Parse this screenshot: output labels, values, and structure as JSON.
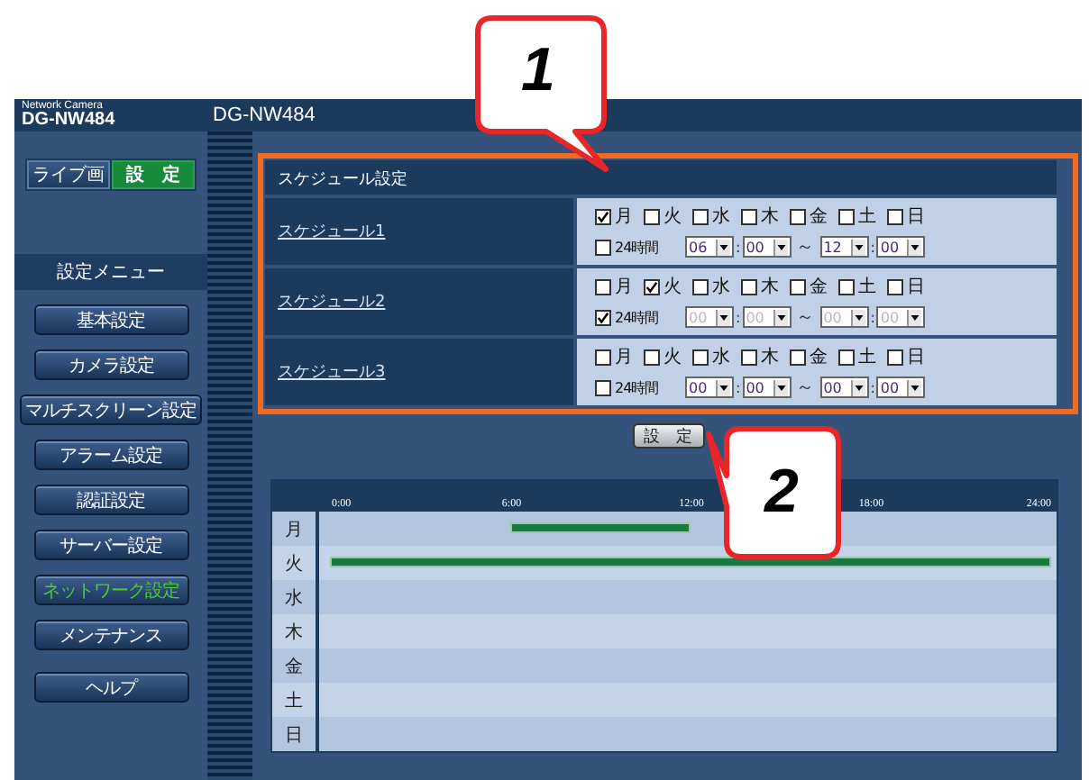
{
  "header": {
    "brand": "Network Camera",
    "model": "DG-NW484",
    "title": "DG-NW484"
  },
  "mode_tabs": [
    {
      "label": "ライブ画",
      "selected": false
    },
    {
      "label": "設　定",
      "selected": true
    }
  ],
  "menu": {
    "title": "設定メニュー",
    "items": [
      {
        "label": "基本設定",
        "selected": false
      },
      {
        "label": "カメラ設定",
        "selected": false
      },
      {
        "label": "マルチスクリーン設定",
        "selected": false
      },
      {
        "label": "アラーム設定",
        "selected": false
      },
      {
        "label": "認証設定",
        "selected": false
      },
      {
        "label": "サーバー設定",
        "selected": false
      },
      {
        "label": "ネットワーク設定",
        "selected": true
      },
      {
        "label": "メンテナンス",
        "selected": false
      },
      {
        "label": "ヘルプ",
        "selected": false
      }
    ]
  },
  "schedule": {
    "title": "スケジュール設定",
    "rows": [
      {
        "name": "スケジュール1",
        "days": [
          {
            "label": "月",
            "checked": true
          },
          {
            "label": "火",
            "checked": false
          },
          {
            "label": "水",
            "checked": false
          },
          {
            "label": "木",
            "checked": false
          },
          {
            "label": "金",
            "checked": false
          },
          {
            "label": "土",
            "checked": false
          },
          {
            "label": "日",
            "checked": false
          }
        ],
        "all_day": {
          "label": "24時間",
          "checked": false
        },
        "start_hour": "06",
        "start_colon": ":",
        "start_minute": "00",
        "range_mark": "～",
        "end_hour": "12",
        "end_colon": ":",
        "end_minute": "00"
      },
      {
        "name": "スケジュール2",
        "days": [
          {
            "label": "月",
            "checked": false
          },
          {
            "label": "火",
            "checked": true
          },
          {
            "label": "水",
            "checked": false
          },
          {
            "label": "木",
            "checked": false
          },
          {
            "label": "金",
            "checked": false
          },
          {
            "label": "土",
            "checked": false
          },
          {
            "label": "日",
            "checked": false
          }
        ],
        "all_day": {
          "label": "24時間",
          "checked": true
        },
        "start_hour": "00",
        "start_colon": ":",
        "start_minute": "00",
        "range_mark": "～",
        "end_hour": "00",
        "end_colon": ":",
        "end_minute": "00"
      },
      {
        "name": "スケジュール3",
        "days": [
          {
            "label": "月",
            "checked": false
          },
          {
            "label": "火",
            "checked": false
          },
          {
            "label": "水",
            "checked": false
          },
          {
            "label": "木",
            "checked": false
          },
          {
            "label": "金",
            "checked": false
          },
          {
            "label": "土",
            "checked": false
          },
          {
            "label": "日",
            "checked": false
          }
        ],
        "all_day": {
          "label": "24時間",
          "checked": false
        },
        "start_hour": "00",
        "start_colon": ":",
        "start_minute": "00",
        "range_mark": "～",
        "end_hour": "00",
        "end_colon": ":",
        "end_minute": "00"
      }
    ]
  },
  "set_button": {
    "label": "設　定"
  },
  "timeline": {
    "hours": [
      "0:00",
      "6:00",
      "12:00",
      "18:00",
      "24:00"
    ],
    "days": [
      "月",
      "火",
      "水",
      "木",
      "金",
      "土",
      "日"
    ]
  },
  "callouts": [
    {
      "number": "1"
    },
    {
      "number": "2"
    }
  ]
}
